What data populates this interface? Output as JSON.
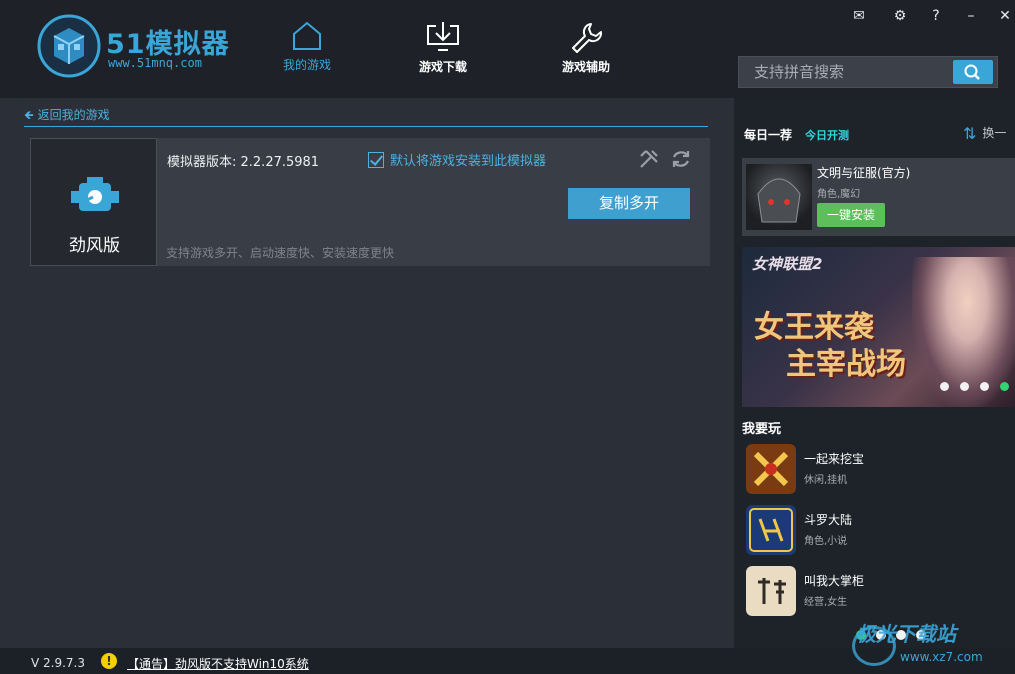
{
  "header": {
    "logo_text": "51模拟器",
    "logo_sub": "www.51mnq.com",
    "nav": [
      {
        "label": "我的游戏",
        "icon": "home-icon",
        "active": true
      },
      {
        "label": "游戏下载",
        "icon": "download-icon",
        "active": false
      },
      {
        "label": "游戏辅助",
        "icon": "wrench-icon",
        "active": false
      }
    ],
    "window_controls": {
      "mail": "✉",
      "settings": "⚙",
      "help": "?",
      "minimize": "–",
      "close": "✕"
    },
    "search_placeholder": "支持拼音搜索"
  },
  "main": {
    "back_label": "返回我的游戏",
    "emulator": {
      "name": "劲风版",
      "version": "模拟器版本: 2.2.27.5981",
      "default_install_label": "默认将游戏安装到此模拟器",
      "copy_button": "复制多开",
      "description": "支持游戏多开、启动速度快、安装速度更快"
    }
  },
  "right_panel": {
    "daily_title": "每日一荐",
    "daily_sub": "今日开测",
    "refresh_label": "换一",
    "featured": {
      "name": "文明与征服(官方)",
      "tags": "角色,魔幻",
      "install_label": "一键安装"
    },
    "banner": {
      "logo_text": "女神联盟2",
      "headline_1": "女王来袭",
      "headline_2": "主宰战场",
      "active_dot": 3
    },
    "play_title": "我要玩",
    "play_list": [
      {
        "name": "一起来挖宝",
        "tags": "休闲,挂机"
      },
      {
        "name": "斗罗大陆",
        "tags": "角色,小说"
      },
      {
        "name": "叫我大掌柜",
        "tags": "经营,女生"
      }
    ]
  },
  "statusbar": {
    "version": "V 2.9.7.3",
    "notice": "【通告】劲风版不支持Win10系统",
    "watermark": "极光下载站",
    "watermark_sub": "www.xz7.com"
  },
  "colors": {
    "accent": "#3aa6d8",
    "install_green": "#5cbf5a",
    "header_bg": "#1e2228",
    "body_bg": "#2b2f37"
  }
}
